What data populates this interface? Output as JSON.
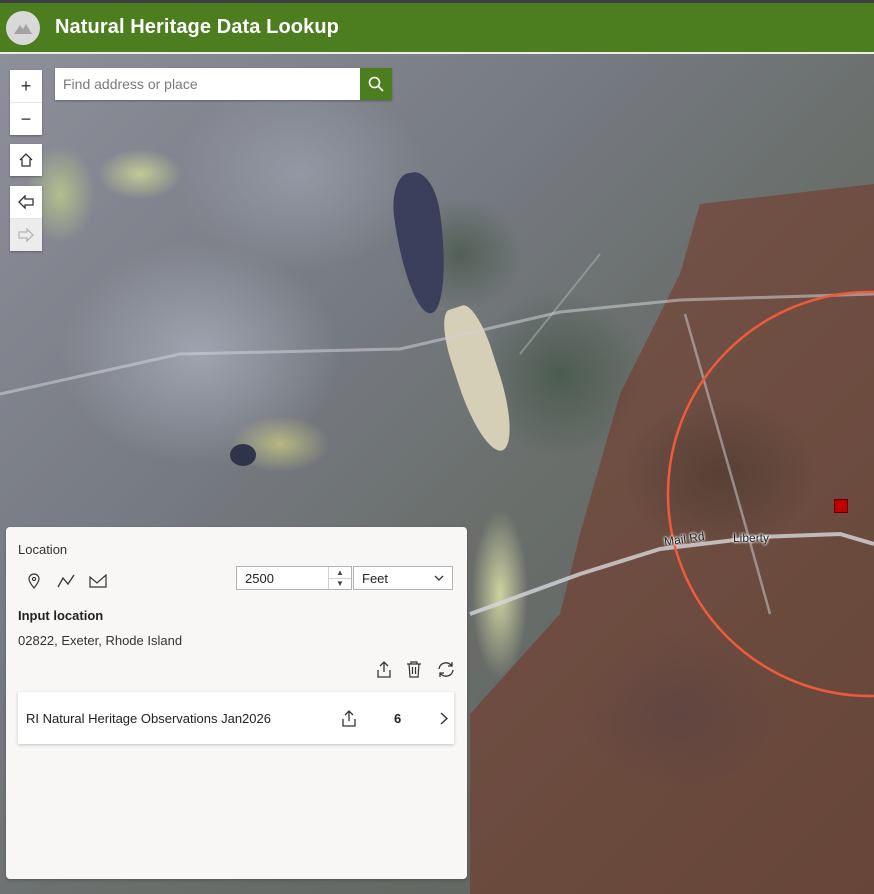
{
  "header": {
    "title": "Natural Heritage Data Lookup",
    "logo_icon": "mountain-icon",
    "background": "#4c7d1f"
  },
  "map_controls": {
    "zoom_in": "+",
    "zoom_out": "−",
    "home_icon": "home-icon",
    "back_icon": "arrow-left-icon",
    "forward_icon": "arrow-right-icon"
  },
  "search": {
    "placeholder": "Find address or place",
    "value": "",
    "button_icon": "search-icon"
  },
  "map_labels": {
    "road": "Mail Rd",
    "place": "Liberty"
  },
  "buffer_color": "#f05a3c",
  "panel": {
    "title": "Location",
    "tools": [
      "point-icon",
      "polyline-icon",
      "polygon-icon"
    ],
    "distance": "2500",
    "unit": "Feet",
    "input_label": "Input location",
    "input_value": "02822, Exeter, Rhode Island",
    "actions": [
      "export-icon",
      "trash-icon",
      "refresh-icon"
    ],
    "results": [
      {
        "name": "RI Natural Heritage Observations Jan2026",
        "count": "6"
      }
    ]
  }
}
